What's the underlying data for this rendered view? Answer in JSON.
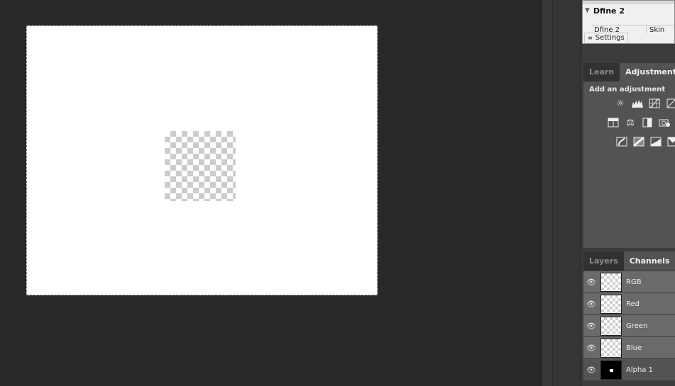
{
  "plugin": {
    "title": "Dfine 2",
    "table_col1": "Dfine 2",
    "table_col2": "Skin",
    "settings_label": "Settings"
  },
  "adjustments_panel": {
    "tabs": [
      {
        "label": "Learn",
        "active": false
      },
      {
        "label": "Adjustments",
        "active": true
      }
    ],
    "add_label": "Add an adjustment",
    "icon_rows": [
      [
        "brightness-contrast-icon",
        "levels-icon",
        "curves-icon",
        "exposure-icon"
      ],
      [
        "hue-saturation-icon",
        "color-balance-icon",
        "black-white-icon",
        "photo-filter-icon"
      ],
      [
        "invert-icon",
        "posterize-icon",
        "threshold-icon",
        "gradient-map-icon"
      ]
    ]
  },
  "channels_panel": {
    "tabs": [
      {
        "label": "Layers",
        "active": false
      },
      {
        "label": "Channels",
        "active": true
      }
    ],
    "channels": [
      {
        "name": "RGB",
        "selected": true,
        "thumb": "transparent"
      },
      {
        "name": "Red",
        "selected": true,
        "thumb": "transparent"
      },
      {
        "name": "Green",
        "selected": true,
        "thumb": "transparent"
      },
      {
        "name": "Blue",
        "selected": true,
        "thumb": "transparent"
      },
      {
        "name": "Alpha 1",
        "selected": false,
        "thumb": "black"
      }
    ]
  },
  "colors": {
    "workspace_bg": "#282828",
    "panel_bg": "#535353",
    "tab_bar_bg": "#323232",
    "selected_row_bg": "#6a6a6a"
  }
}
